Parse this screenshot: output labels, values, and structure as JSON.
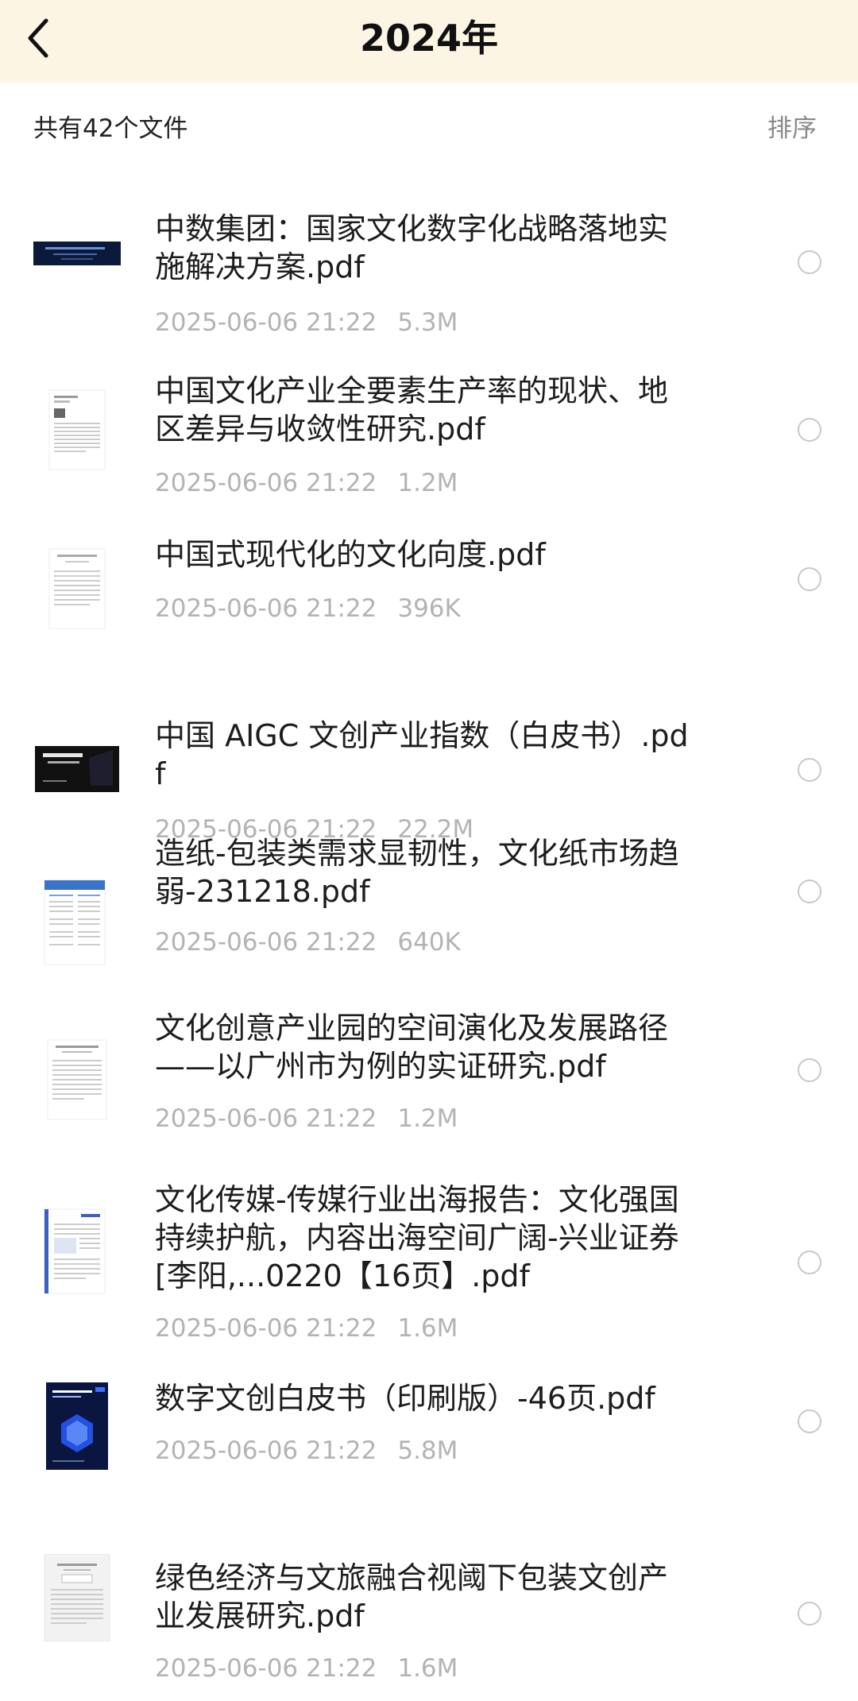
{
  "header": {
    "title": "2024年"
  },
  "summary": {
    "file_count": "共有42个文件",
    "sort_label": "排序"
  },
  "files": [
    {
      "name": "中数集团：国家文化数字化战略落地实施解决方案.pdf",
      "date": "2025-06-06 21:22",
      "size": "5.3M",
      "thumb": "dark-banner"
    },
    {
      "name": "中国文化产业全要素生产率的现状、地区差异与收敛性研究.pdf",
      "date": "2025-06-06 21:22",
      "size": "1.2M",
      "thumb": "text-page"
    },
    {
      "name": "中国式现代化的文化向度.pdf",
      "date": "2025-06-06 21:22",
      "size": "396K",
      "thumb": "text-page"
    },
    {
      "name": "中国 AIGC 文创产业指数（白皮书）.pdf",
      "date": "2025-06-06 21:22",
      "size": "22.2M",
      "thumb": "black-banner"
    },
    {
      "name": "造纸-包装类需求显韧性，文化纸市场趋弱-231218.pdf",
      "date": "2025-06-06 21:22",
      "size": "640K",
      "thumb": "report-page"
    },
    {
      "name": "文化创意产业园的空间演化及发展路径——以广州市为例的实证研究.pdf",
      "date": "2025-06-06 21:22",
      "size": "1.2M",
      "thumb": "text-page"
    },
    {
      "name": "文化传媒-传媒行业出海报告：文化强国持续护航，内容出海空间广阔-兴业证券[李阳,...0220【16页】.pdf",
      "date": "2025-06-06 21:22",
      "size": "1.6M",
      "thumb": "report-page-blue"
    },
    {
      "name": "数字文创白皮书（印刷版）-46页.pdf",
      "date": "2025-06-06 21:22",
      "size": "5.8M",
      "thumb": "blue-cover"
    },
    {
      "name": "绿色经济与文旅融合视阈下包装文创产业发展研究.pdf",
      "date": "2025-06-06 21:22",
      "size": "1.6M",
      "thumb": "text-page-gray"
    }
  ],
  "colors": {
    "header_bg": "#fcf5e3",
    "meta_text": "#b3b3b3",
    "radio_border": "#c8c8c8"
  },
  "icons": {
    "back": "chevron-left-icon",
    "select": "radio-circle-icon"
  }
}
